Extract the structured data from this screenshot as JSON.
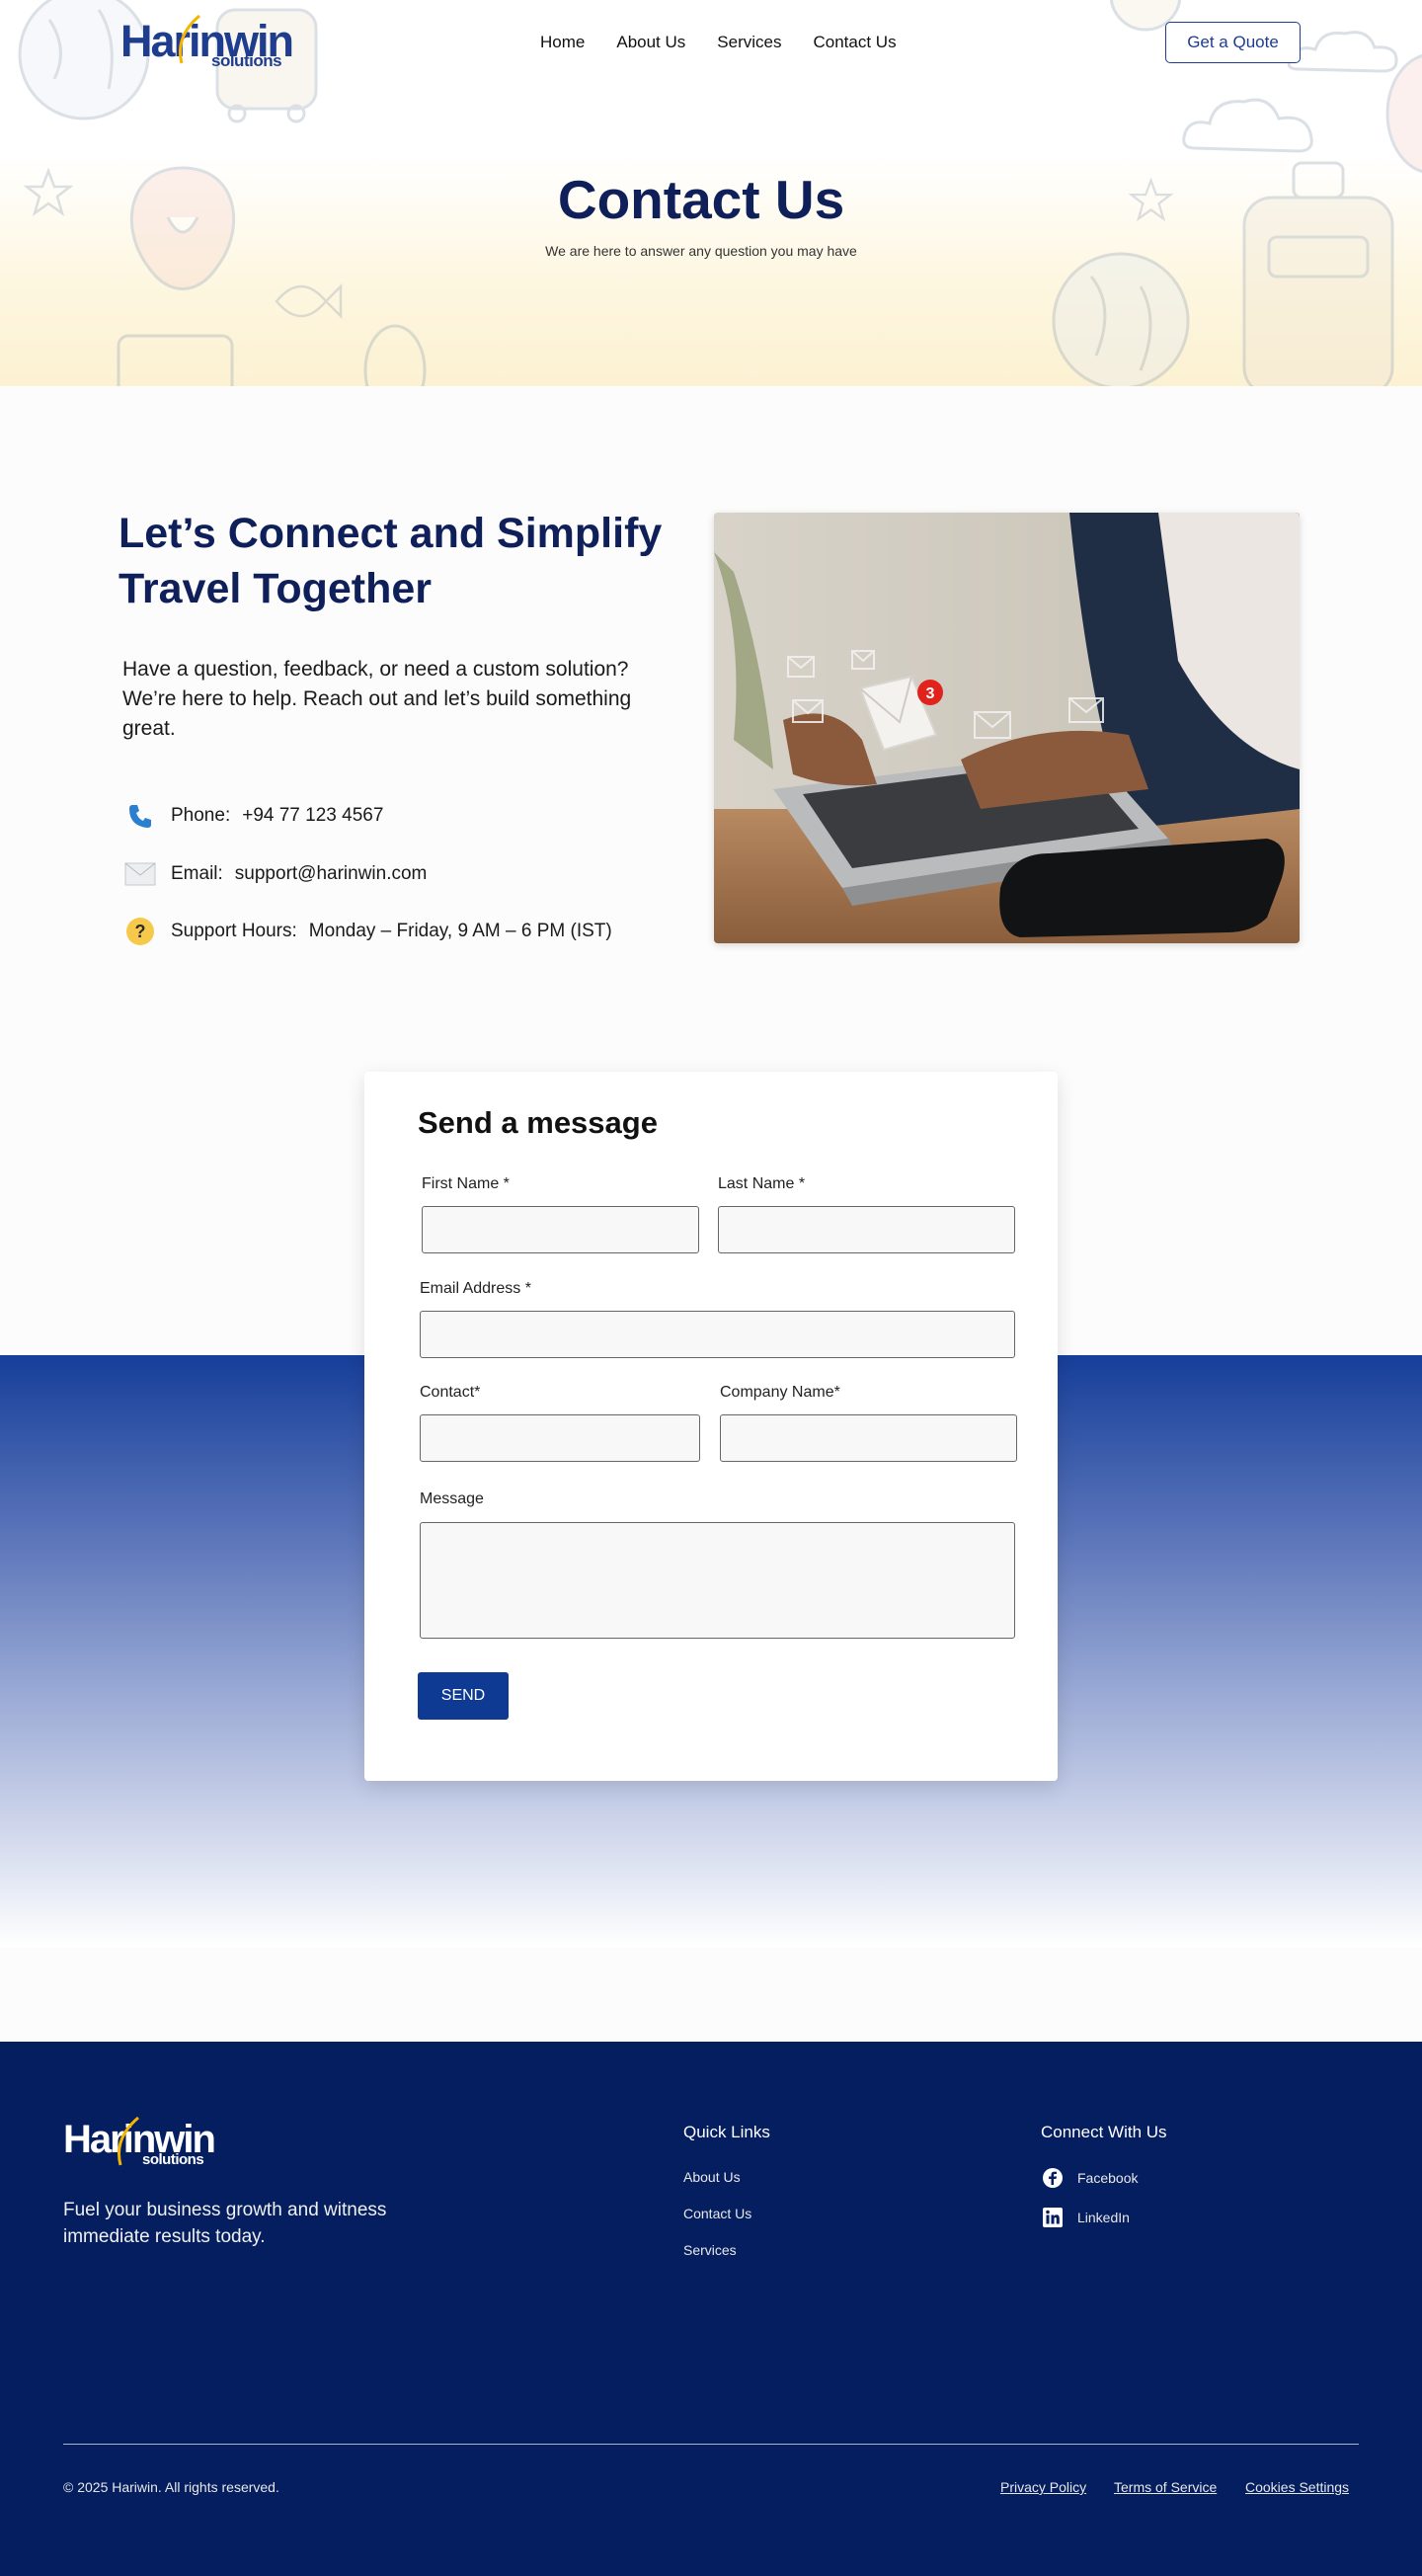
{
  "brand": {
    "logo_main": "Harinwin",
    "logo_sub": "solutions",
    "primary": "#1e3d8f",
    "navy": "#0e1f5a",
    "footer_bg": "#041e5f",
    "accent_gold": "#f4b400"
  },
  "nav": {
    "items": [
      "Home",
      "About Us",
      "Services",
      "Contact Us"
    ],
    "cta": "Get a Quote"
  },
  "hero": {
    "title": "Contact Us",
    "subtitle": "We are here to answer any question you may have"
  },
  "connect": {
    "title": "Let’s Connect and Simplify Travel Together",
    "text": "Have a question, feedback, or need a custom solution? We’re here to help. Reach out and let’s build something great.",
    "phone_label": "Phone:",
    "phone_value": "+94 77 123 4567",
    "email_label": "Email:",
    "email_value": "support@harinwin.com",
    "hours_label": "Support Hours:",
    "hours_value": "Monday – Friday, 9 AM – 6 PM (IST)",
    "image_badge": "3",
    "icons": [
      "phone-icon",
      "mail-icon",
      "question-icon"
    ]
  },
  "form": {
    "title": "Send a message",
    "first_name_label": "First Name *",
    "last_name_label": "Last Name *",
    "email_label": "Email Address *",
    "contact_label": "Contact*",
    "company_label": "Company Name*",
    "message_label": "Message",
    "send_label": "SEND"
  },
  "footer": {
    "tagline": "Fuel your business growth and witness immediate results today.",
    "quick_links_title": "Quick Links",
    "quick_links": [
      "About Us",
      "Contact Us",
      "Services"
    ],
    "connect_title": "Connect With Us",
    "social": [
      "Facebook",
      "LinkedIn"
    ],
    "copyright": "© 2025 Hariwin. All rights reserved.",
    "legal": [
      "Privacy Policy",
      "Terms of Service",
      "Cookies Settings"
    ]
  }
}
